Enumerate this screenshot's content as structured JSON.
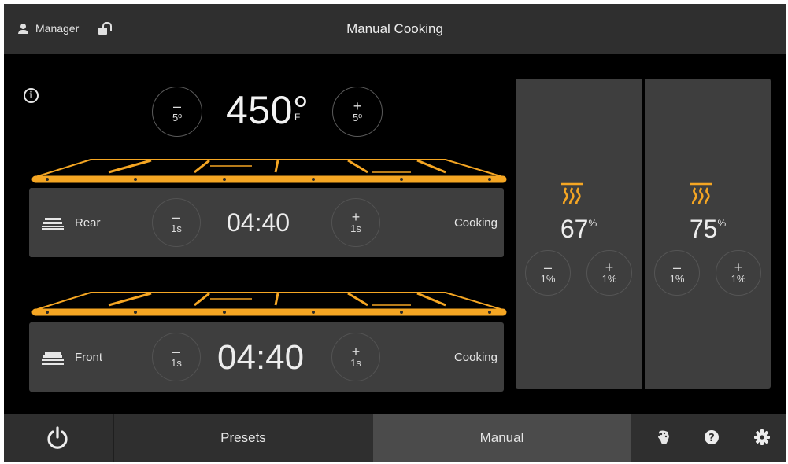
{
  "header": {
    "user_label": "Manager",
    "title": "Manual Cooking"
  },
  "temperature": {
    "value": "450°",
    "unit": "F",
    "decrement_symbol": "–",
    "decrement_amount": "5º",
    "increment_symbol": "+",
    "increment_amount": "5º"
  },
  "zones": [
    {
      "label": "Rear",
      "time": "04:40",
      "status": "Cooking",
      "decrement_symbol": "–",
      "decrement_amount": "1s",
      "increment_symbol": "+",
      "increment_amount": "1s"
    },
    {
      "label": "Front",
      "time": "04:40",
      "status": "Cooking",
      "decrement_symbol": "–",
      "decrement_amount": "1s",
      "increment_symbol": "+",
      "increment_amount": "1s"
    }
  ],
  "heaters": [
    {
      "value": "67",
      "unit": "%",
      "decrement_symbol": "–",
      "decrement_amount": "1%",
      "increment_symbol": "+",
      "increment_amount": "1%"
    },
    {
      "value": "75",
      "unit": "%",
      "decrement_symbol": "–",
      "decrement_amount": "1%",
      "increment_symbol": "+",
      "increment_amount": "1%"
    }
  ],
  "footer": {
    "presets_label": "Presets",
    "manual_label": "Manual",
    "active_tab": "Manual"
  },
  "colors": {
    "accent": "#f5a623",
    "background": "#000000",
    "panel": "#3e3e3e",
    "bar": "#2f2f2f",
    "active_tab": "#4b4b4b"
  },
  "icons": {
    "user": "user-icon",
    "lock": "unlock-icon",
    "info": "info-icon",
    "heat": "heat-waves-icon",
    "power": "power-icon",
    "clean": "clean-hand-icon",
    "help": "help-icon",
    "settings": "gear-icon"
  }
}
